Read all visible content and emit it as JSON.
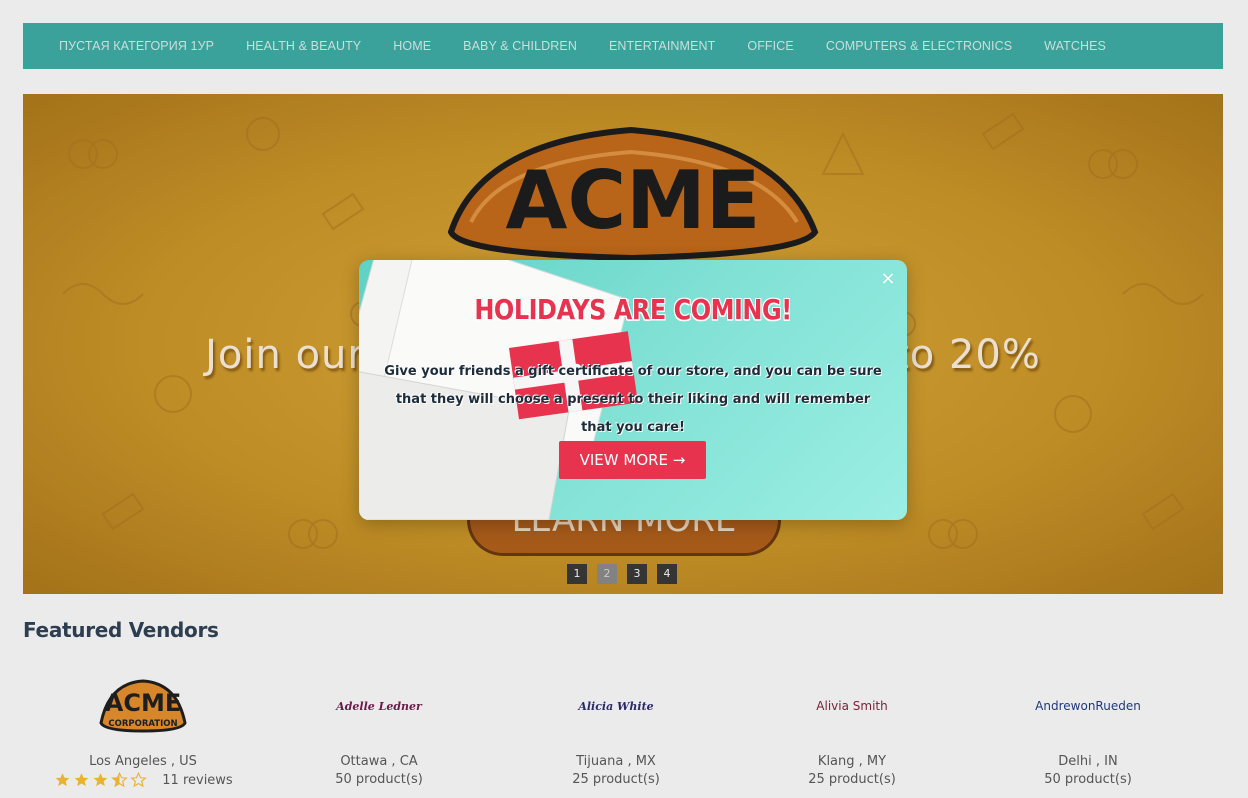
{
  "nav": {
    "items": [
      "ПУСТАЯ КАТЕГОРИЯ 1УР",
      "HEALTH & BEAUTY",
      "HOME",
      "BABY & CHILDREN",
      "ENTERTAINMENT",
      "OFFICE",
      "COMPUTERS & ELECTRONICS",
      "WATCHES"
    ]
  },
  "banner": {
    "logo_text": "ACME",
    "promo_text": "Join our mailing list and save up to 20%",
    "button_label": "LEARN MORE",
    "slides": [
      "1",
      "2",
      "3",
      "4"
    ],
    "active_slide": "2"
  },
  "modal": {
    "title": "HOLIDAYS ARE COMING!",
    "body": "Give your friends a gift certificate of our store, and you can be sure that they will choose a present to their liking and will remember that you care!",
    "button_label": "VIEW MORE →",
    "close_glyph": "×"
  },
  "featured": {
    "title": "Featured Vendors",
    "vendors": [
      {
        "logo_text": "ACME",
        "logo_subtext": "CORPORATION",
        "location": "Los Angeles , US",
        "stars": 3.5,
        "reviews": "11 reviews"
      },
      {
        "logo_text": "Adelle Ledner",
        "location": "Ottawa , CA",
        "products": "50 product(s)",
        "logo_color": "#6b1a4a"
      },
      {
        "logo_text": "Alicia White",
        "location": "Tijuana , MX",
        "products": "25 product(s)",
        "logo_color": "#2a2a6a"
      },
      {
        "logo_text": "Alivia Smith",
        "location": "Klang , MY",
        "products": "25 product(s)",
        "logo_color": "#7a1f3a"
      },
      {
        "logo_text": "AndrewonRueden",
        "location": "Delhi , IN",
        "products": "50 product(s)",
        "logo_color": "#1f3a7a"
      }
    ]
  },
  "colors": {
    "nav_bg": "#3fb0a8",
    "accent_red": "#e8334f",
    "star": "#e9b230",
    "title": "#2d3e50"
  }
}
